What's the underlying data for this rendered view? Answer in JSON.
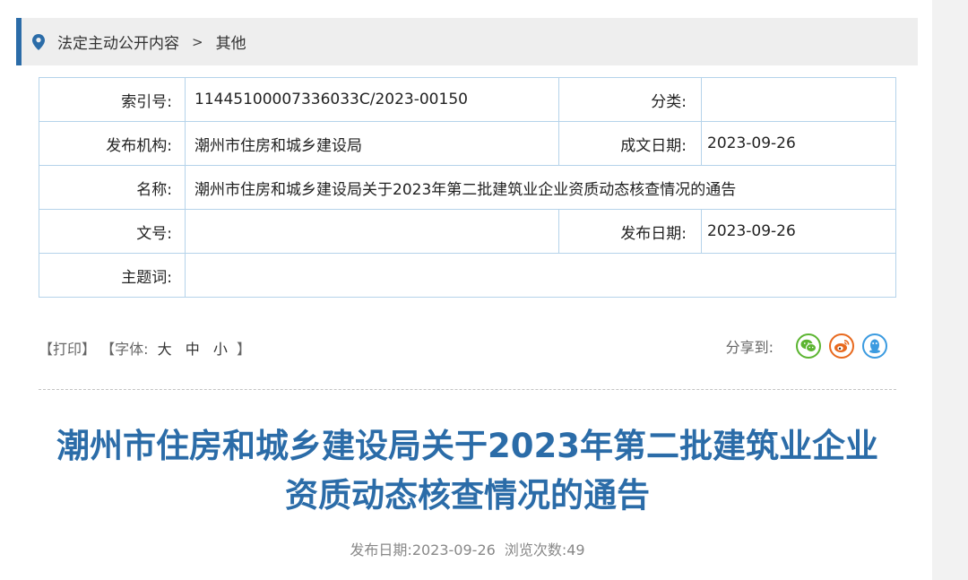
{
  "breadcrumb": {
    "section": "法定主动公开内容",
    "current": "其他",
    "separator": ">"
  },
  "meta": {
    "index_label": "索引号:",
    "index_value": "11445100007336033C/2023-00150",
    "category_label": "分类:",
    "category_value": "",
    "agency_label": "发布机构:",
    "agency_value": "潮州市住房和城乡建设局",
    "written_date_label": "成文日期:",
    "written_date_value": "2023-09-26",
    "name_label": "名称:",
    "name_value": "潮州市住房和城乡建设局关于2023年第二批建筑业企业资质动态核查情况的通告",
    "doc_no_label": "文号:",
    "doc_no_value": "",
    "publish_date_label": "发布日期:",
    "publish_date_value": "2023-09-26",
    "keywords_label": "主题词:",
    "keywords_value": ""
  },
  "toolbar": {
    "print": "【打印】",
    "font_prefix": "【字体:",
    "font_large": "大",
    "font_medium": "中",
    "font_small": "小",
    "font_suffix": "】",
    "share_label": "分享到:"
  },
  "share_icons": [
    "wechat-icon",
    "weibo-icon",
    "qq-icon"
  ],
  "article": {
    "title_line1": "潮州市住房和城乡建设局关于2023年第二批建筑业企业",
    "title_line2": "资质动态核查情况的通告",
    "publish_info": "发布日期:2023-09-26",
    "views_info": "浏览次数:49"
  },
  "colors": {
    "accent": "#2b6ca8",
    "border": "#b5d3ea",
    "wechat": "#5cb531",
    "weibo": "#e8691e",
    "qq": "#3b9be0"
  }
}
